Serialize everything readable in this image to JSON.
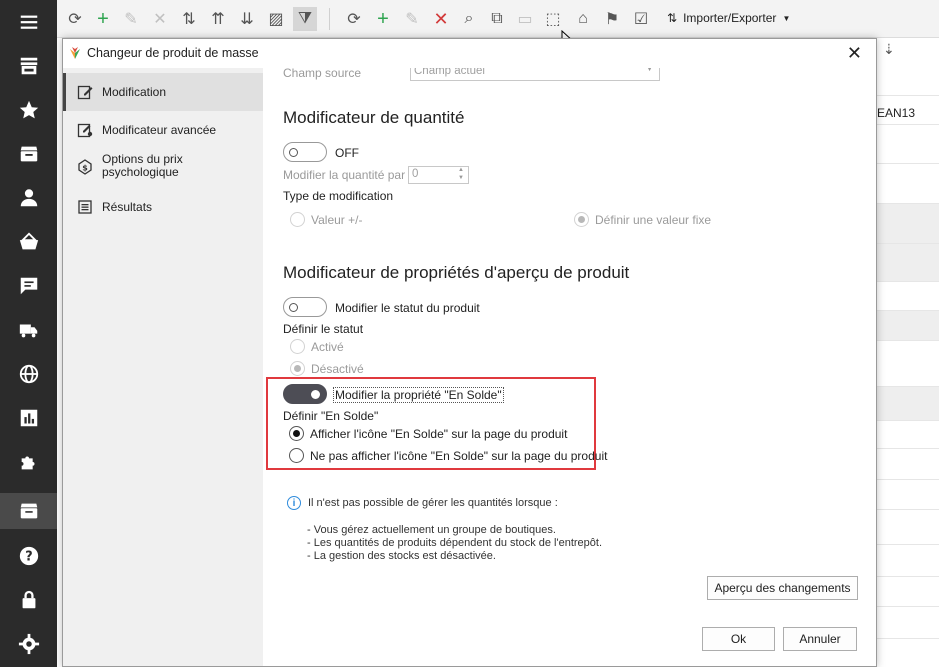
{
  "toolbar": {
    "import_export_label": "Importer/Exporter",
    "buttons": [
      "refresh-icon",
      "add-icon",
      "edit-icon",
      "delete-icon",
      "sort-icon",
      "import-up-icon",
      "import-down-icon",
      "image-icon",
      "filter-icon",
      "refresh-icon",
      "add-icon",
      "edit-icon",
      "delete-icon",
      "search-icon",
      "copy-icon",
      "paste-icon",
      "clone-icon",
      "category-icon",
      "unassign-icon",
      "assign-icon",
      "import-export-icon"
    ]
  },
  "background": {
    "column_header": "EAN13"
  },
  "dialog": {
    "title": "Changeur de produit de masse",
    "nav": [
      {
        "label": "Modification",
        "icon": "edit-note-icon"
      },
      {
        "label": "Modificateur avancée",
        "icon": "advanced-edit-icon"
      },
      {
        "label": "Options du prix psychologique",
        "icon": "price-tag-icon"
      },
      {
        "label": "Résultats",
        "icon": "list-icon"
      }
    ],
    "top_field": {
      "label": "Champ source",
      "value": "Champ actuel"
    },
    "quantity": {
      "title": "Modificateur de quantité",
      "toggle_label": "OFF",
      "modify_by_label": "Modifier la quantité par",
      "modify_by_value": "0",
      "type_label": "Type de modification",
      "option1": "Valeur +/-",
      "option2": "Définir une valeur fixe"
    },
    "preview": {
      "title": "Modificateur de propriétés d'aperçu de produit",
      "status_toggle_label": "Modifier le statut du produit",
      "status_label": "Définir le statut",
      "active": "Activé",
      "inactive": "Désactivé",
      "sale_toggle_label": "Modifier la propriété \"En Solde\"",
      "sale_label": "Définir \"En Solde\"",
      "sale_show": "Afficher l'icône \"En Solde\" sur la page du produit",
      "sale_hide": "Ne pas afficher l'icône \"En Solde\" sur la page du produit"
    },
    "info": {
      "heading": "Il n'est pas possible de gérer les quantités lorsque :",
      "lines": [
        "- Vous gérez actuellement un groupe de boutiques.",
        "- Les quantités de produits dépendent du stock de l'entrepôt.",
        "- La gestion des stocks est désactivée."
      ]
    },
    "preview_button": "Aperçu des changements",
    "ok_button": "Ok",
    "cancel_button": "Annuler"
  },
  "colors": {
    "highlight": "#e0393e",
    "rail": "#2b2b2b",
    "info": "#2e8bdc",
    "add": "#2ea44f",
    "delete": "#d23a3a"
  }
}
